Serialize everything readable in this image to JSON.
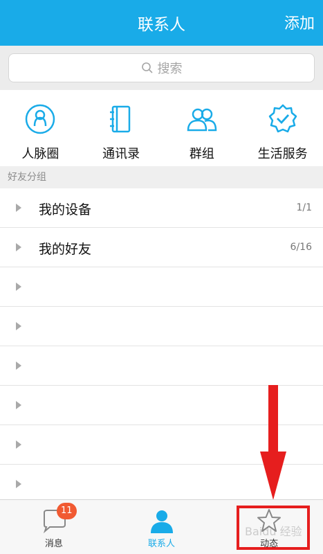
{
  "header": {
    "title": "联系人",
    "add_label": "添加"
  },
  "search": {
    "placeholder": "搜索"
  },
  "quick_access": [
    {
      "label": "人脉圈",
      "icon": "contacts-circle-icon"
    },
    {
      "label": "通讯录",
      "icon": "address-book-icon"
    },
    {
      "label": "群组",
      "icon": "group-icon"
    },
    {
      "label": "生活服务",
      "icon": "verified-badge-icon"
    }
  ],
  "section": {
    "label": "好友分组"
  },
  "groups": [
    {
      "name": "我的设备",
      "count": "1/1"
    },
    {
      "name": "我的好友",
      "count": "6/16"
    },
    {
      "name": "",
      "count": ""
    },
    {
      "name": "",
      "count": ""
    },
    {
      "name": "",
      "count": ""
    },
    {
      "name": "",
      "count": ""
    },
    {
      "name": "",
      "count": ""
    },
    {
      "name": "",
      "count": ""
    }
  ],
  "tabbar": {
    "tabs": [
      {
        "label": "消息",
        "icon": "chat-bubble-icon",
        "badge": "11"
      },
      {
        "label": "联系人",
        "icon": "person-icon",
        "active": true
      },
      {
        "label": "动态",
        "icon": "star-icon"
      }
    ]
  },
  "colors": {
    "accent": "#19abe8",
    "badge": "#f15a32",
    "highlight": "#e61e1e"
  },
  "watermark": "Baidu 经验"
}
